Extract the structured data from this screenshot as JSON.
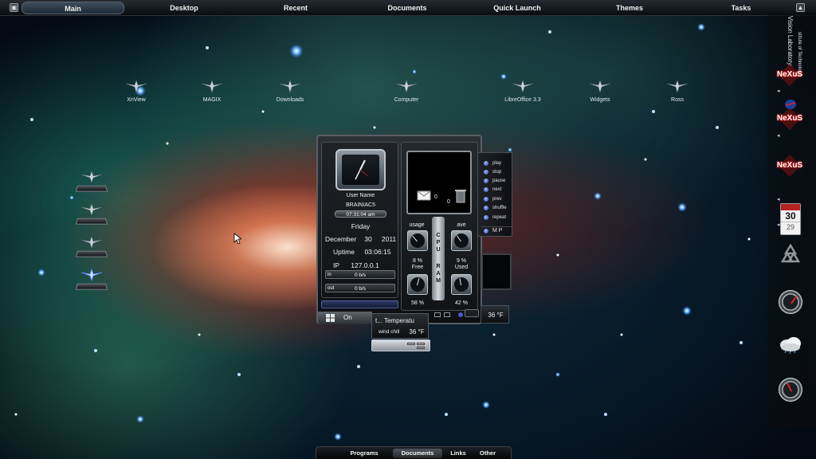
{
  "topbar": {
    "items": [
      {
        "label": "Main",
        "active": true
      },
      {
        "label": "Desktop"
      },
      {
        "label": "Recent"
      },
      {
        "label": "Documents"
      },
      {
        "label": "Quick Launch"
      },
      {
        "label": "Themes"
      },
      {
        "label": "Tasks"
      }
    ],
    "left_icon": "window-icon",
    "right_icon": "collapse-up-icon"
  },
  "desktop_icons": [
    {
      "label": "XnView"
    },
    {
      "label": "MAGIX"
    },
    {
      "label": "Downloads"
    },
    {
      "label": "Computer"
    },
    {
      "label": "LibreOffice 3.3"
    },
    {
      "label": "Widgets"
    },
    {
      "label": "Ross"
    }
  ],
  "system_widget": {
    "user_label": "User Name",
    "user_name": "BRAINIAC5",
    "time": "07:31:04 am",
    "weekday": "Friday",
    "month": "December",
    "day": "30",
    "year": "2011",
    "uptime_label": "Uptime",
    "uptime": "03:06:15",
    "ip_label": "IP",
    "ip": "127.0.0.1",
    "in_label": "in",
    "in_rate": "0 b/s",
    "out_label": "out",
    "out_rate": "0 b/s",
    "mail_count": "0",
    "trash_count": "0",
    "cpu_usage_label": "usage",
    "cpu_ave_label": "ave",
    "cpu_letters": [
      "C",
      "P",
      "U"
    ],
    "ram_letters": [
      "R",
      "A",
      "M"
    ],
    "cpu_usage": "8 %",
    "cpu_ave": "9 %",
    "ram_free_label": "Free",
    "ram_used_label": "Used",
    "ram_free": "58 %",
    "ram_used": "42 %",
    "on_label": "On",
    "temp_small": "36 °F"
  },
  "media_player": {
    "items": [
      "play",
      "stop",
      "pause",
      "next",
      "prev",
      "shuffle",
      "repeat"
    ],
    "footer": "M P"
  },
  "weather_popup": {
    "title": "t... Temperatu",
    "wind_chill_label": "wind chill",
    "wind_chill": "36 °F"
  },
  "bottombar": {
    "items": [
      {
        "label": "Programs"
      },
      {
        "label": "Documents",
        "active": true
      },
      {
        "label": "Links"
      },
      {
        "label": "Other"
      }
    ]
  },
  "right_dock": {
    "vertical_text": "Vision Laboratory",
    "vertical_text_2": "stitute of Technology",
    "nexus_label": "NeXuS",
    "calendar_day": "30",
    "calendar_day_next": "29"
  },
  "colors": {
    "accent_blue": "#3f5fd0",
    "nexus_red": "#c61616",
    "panel_bg": "#111315"
  }
}
